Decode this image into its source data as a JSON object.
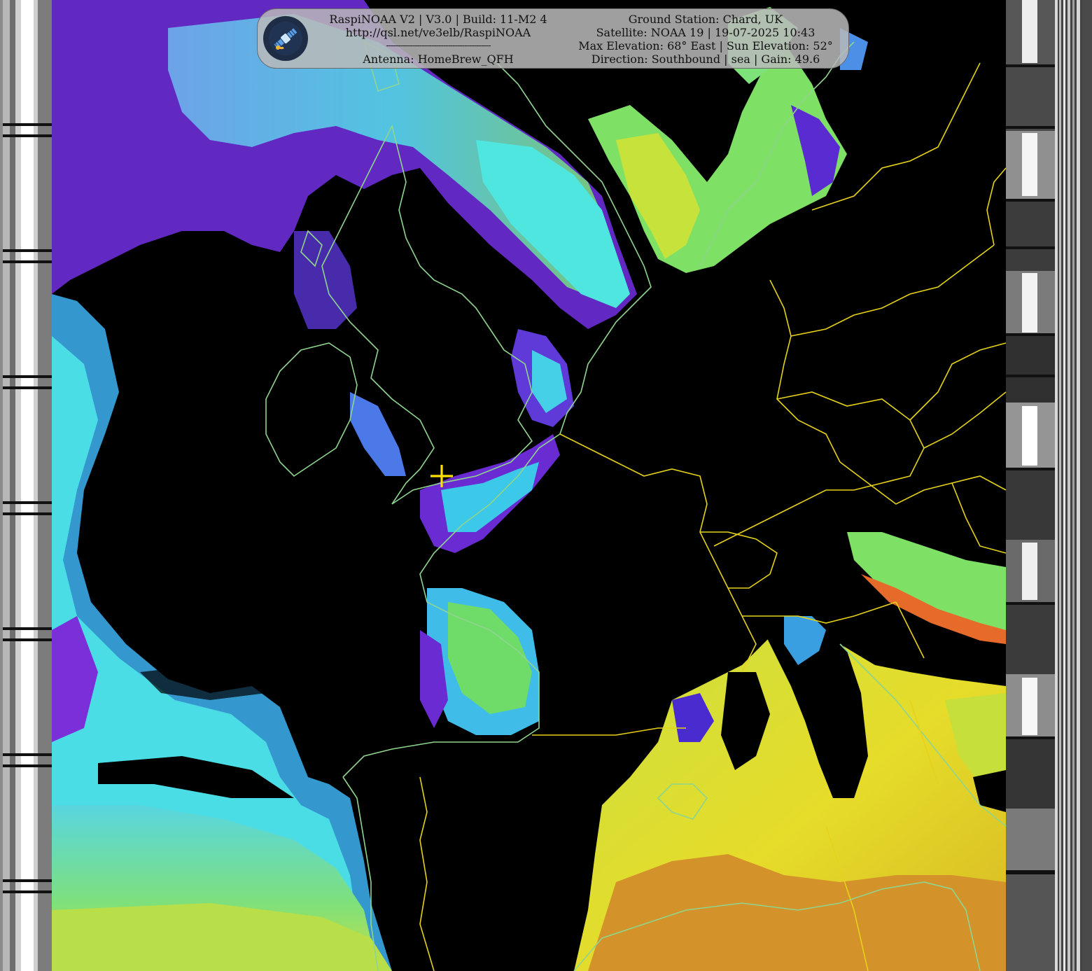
{
  "banner": {
    "left": {
      "line1": "RaspiNOAA V2 | V3.0 | Build: 11-M2 4",
      "line2": "http://qsl.net/ve3elb/RaspiNOAA",
      "line3": "--------------------------------------------",
      "line4": "Antenna: HomeBrew_QFH"
    },
    "right": {
      "line1": "Ground Station: Chard, UK",
      "line2": "Satellite: NOAA 19 | 19-07-2025 10:43",
      "line3": "Max Elevation: 68° East | Sun Elevation: 52°",
      "line4": "Direction: Southbound | sea | Gain: 49.6"
    }
  },
  "colors": {
    "background": "#000000",
    "coast": "#8fd48f",
    "border": "#e6d21a",
    "marker": "#ffe000",
    "banner": "#b9b9b9"
  },
  "icons": {
    "logo": "satellite-logo-icon",
    "marker": "ground-station-crosshair-icon"
  }
}
